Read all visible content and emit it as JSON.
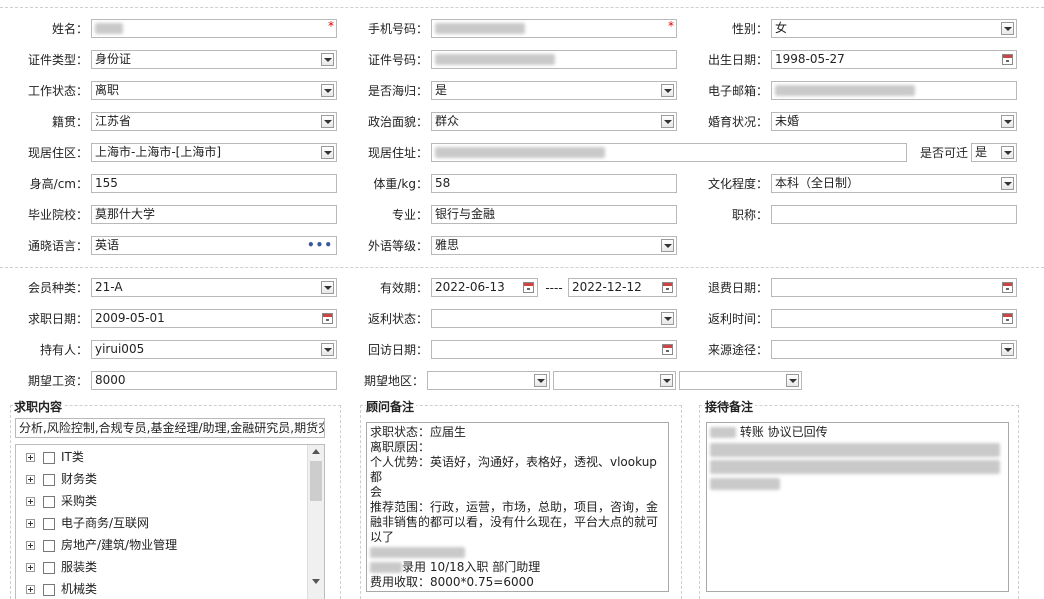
{
  "section1": {
    "name": {
      "label": "姓名：",
      "value": ""
    },
    "phone": {
      "label": "手机号码：",
      "value": ""
    },
    "gender": {
      "label": "性别：",
      "value": "女"
    },
    "id_type": {
      "label": "证件类型：",
      "value": "身份证"
    },
    "id_number": {
      "label": "证件号码：",
      "value": ""
    },
    "birth_date": {
      "label": "出生日期：",
      "value": "1998-05-27"
    },
    "work_status": {
      "label": "工作状态：",
      "value": "离职"
    },
    "overseas_returnee": {
      "label": "是否海归：",
      "value": "是"
    },
    "email": {
      "label": "电子邮箱：",
      "value": ""
    },
    "native_place": {
      "label": "籍贯：",
      "value": "江苏省"
    },
    "political_status": {
      "label": "政治面貌：",
      "value": "群众"
    },
    "marital_status": {
      "label": "婚育状况：",
      "value": "未婚"
    },
    "current_area": {
      "label": "现居住区：",
      "value": "上海市-上海市-[上海市]"
    },
    "current_address": {
      "label": "现居住址：",
      "value": ""
    },
    "relocatable": {
      "label": "是否可迁",
      "value": "是"
    },
    "height": {
      "label": "身高/cm：",
      "value": "155"
    },
    "weight": {
      "label": "体重/kg：",
      "value": "58"
    },
    "education": {
      "label": "文化程度：",
      "value": "本科（全日制）"
    },
    "school": {
      "label": "毕业院校：",
      "value": "莫那什大学"
    },
    "major": {
      "label": "专业：",
      "value": "银行与金融"
    },
    "title": {
      "label": "职称：",
      "value": ""
    },
    "language": {
      "label": "通晓语言：",
      "value": "英语"
    },
    "language_level": {
      "label": "外语等级：",
      "value": "雅思"
    }
  },
  "section2": {
    "member_type": {
      "label": "会员种类：",
      "value": "21-A"
    },
    "validity": {
      "label": "有效期：",
      "start": "2022-06-13",
      "separator": "----",
      "end": "2022-12-12"
    },
    "refund_date": {
      "label": "退费日期：",
      "value": ""
    },
    "job_search_date": {
      "label": "求职日期：",
      "value": "2009-05-01"
    },
    "rebate_status": {
      "label": "返利状态：",
      "value": ""
    },
    "rebate_time": {
      "label": "返利时间：",
      "value": ""
    },
    "holder": {
      "label": "持有人：",
      "value": "yirui005"
    },
    "callback_date": {
      "label": "回访日期：",
      "value": ""
    },
    "source": {
      "label": "来源途径：",
      "value": ""
    },
    "expected_salary": {
      "label": "期望工资：",
      "value": "8000"
    },
    "expected_area": {
      "label": "期望地区：",
      "values": [
        "",
        "",
        ""
      ]
    }
  },
  "job_content": {
    "title": "求职内容",
    "input_value": "分析,风险控制,合规专员,基金经理/助理,金融研究员,期货交",
    "tree": [
      "IT类",
      "财务类",
      "采购类",
      "电子商务/互联网",
      "房地产/建筑/物业管理",
      "服装类",
      "机械类"
    ]
  },
  "consultant_notes": {
    "title": "顾问备注",
    "lines": [
      "求职状态：应届生",
      "离职原因：",
      "个人优势：英语好，沟通好，表格好，透视、vlookup都",
      "会",
      "推荐范围：行政，运营，市场，总助，项目，咨询，金",
      "融非销售的都可以看，没有什么现在，平台大点的就可",
      "以了",
      "",
      "录用    10/18入职  部门助理",
      "费用收取：8000*0.75=6000"
    ]
  },
  "reception_notes": {
    "title": "接待备注",
    "line1": "转账 协议已回传"
  }
}
